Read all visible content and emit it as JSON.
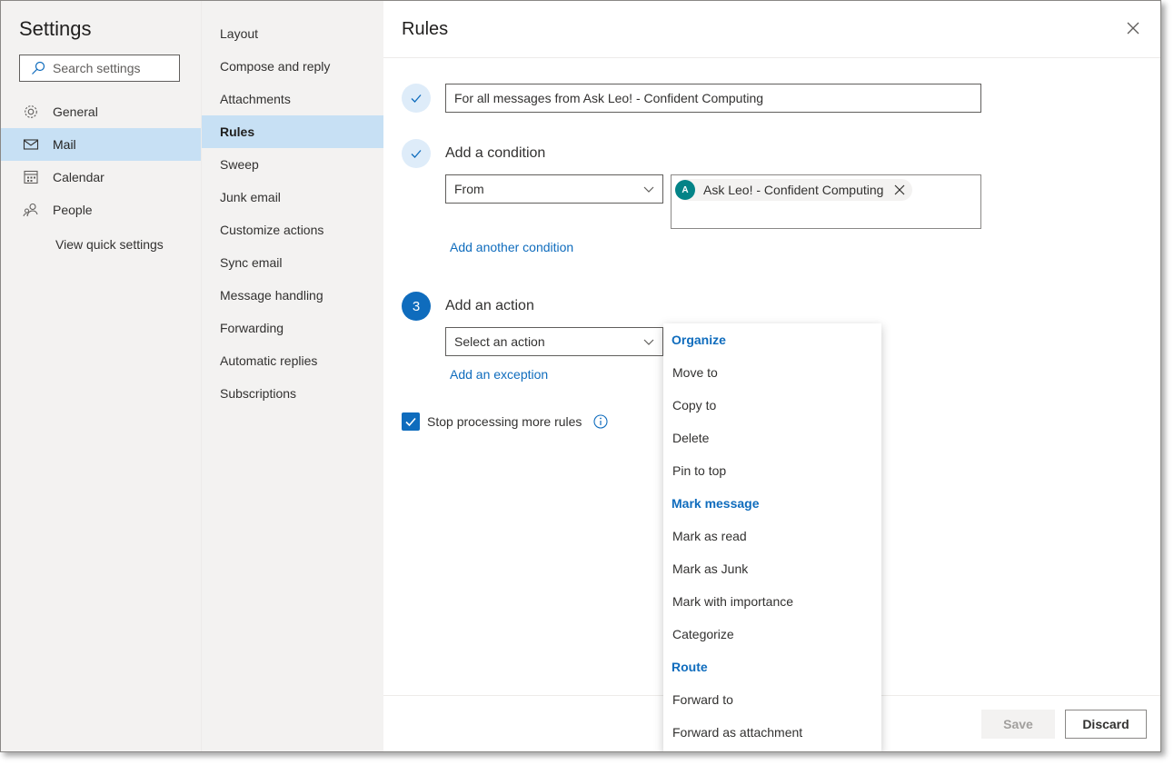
{
  "settings": {
    "title": "Settings",
    "search_placeholder": "Search settings",
    "nav": [
      {
        "label": "General",
        "icon": "gear-icon"
      },
      {
        "label": "Mail",
        "icon": "mail-icon",
        "active": true
      },
      {
        "label": "Calendar",
        "icon": "calendar-icon"
      },
      {
        "label": "People",
        "icon": "people-icon"
      }
    ],
    "quick_settings": "View quick settings"
  },
  "categories": [
    "Layout",
    "Compose and reply",
    "Attachments",
    "Rules",
    "Sweep",
    "Junk email",
    "Customize actions",
    "Sync email",
    "Message handling",
    "Forwarding",
    "Automatic replies",
    "Subscriptions"
  ],
  "active_category": "Rules",
  "rules": {
    "title": "Rules",
    "rule_name": "For all messages from Ask Leo! - Confident Computing",
    "condition_label": "Add a condition",
    "condition_type": "From",
    "from_chip": {
      "initial": "A",
      "name": "Ask Leo! - Confident Computing"
    },
    "add_condition_link": "Add another condition",
    "step_number": "3",
    "action_label": "Add an action",
    "action_placeholder": "Select an action",
    "add_exception_link": "Add an exception",
    "stop_processing": "Stop processing more rules",
    "stop_processing_checked": true,
    "save_label": "Save",
    "discard_label": "Discard"
  },
  "action_menu": [
    {
      "label": "Organize",
      "header": true
    },
    {
      "label": "Move to"
    },
    {
      "label": "Copy to"
    },
    {
      "label": "Delete"
    },
    {
      "label": "Pin to top"
    },
    {
      "label": "Mark message",
      "header": true
    },
    {
      "label": "Mark as read"
    },
    {
      "label": "Mark as Junk"
    },
    {
      "label": "Mark with importance"
    },
    {
      "label": "Categorize"
    },
    {
      "label": "Route",
      "header": true
    },
    {
      "label": "Forward to"
    },
    {
      "label": "Forward as attachment"
    }
  ],
  "colors": {
    "accent": "#0f6cbd",
    "nav_active": "#c7e0f4",
    "avatar": "#038387"
  }
}
